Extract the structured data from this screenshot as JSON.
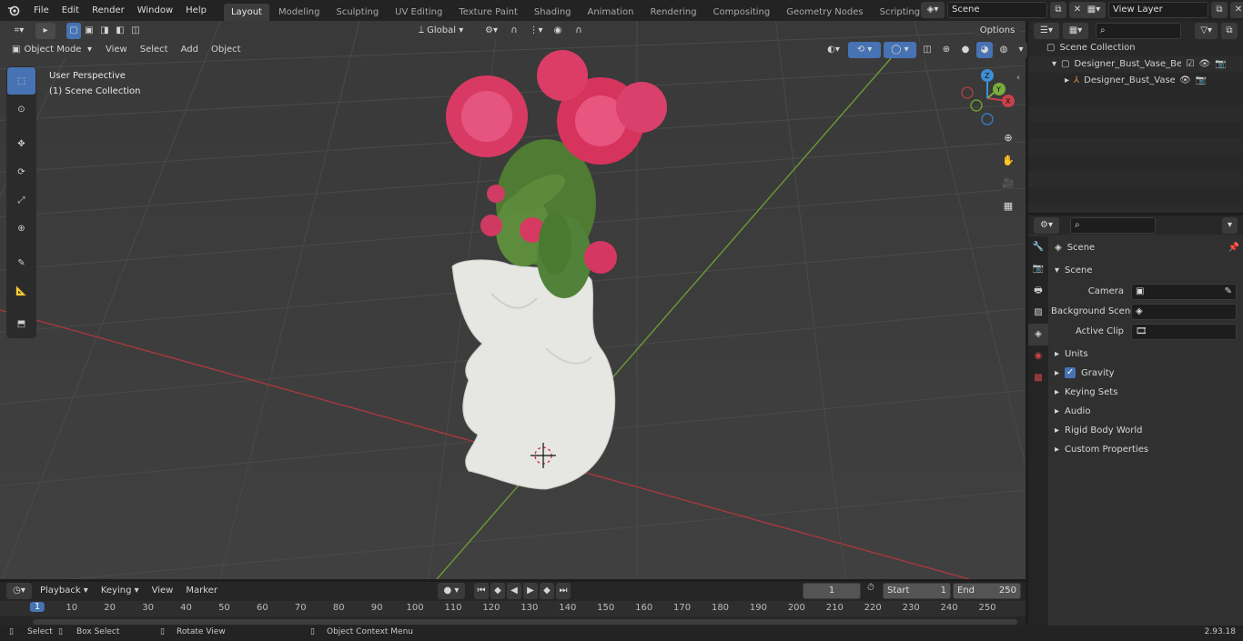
{
  "menubar": {
    "file": "File",
    "edit": "Edit",
    "render": "Render",
    "window": "Window",
    "help": "Help"
  },
  "workspaces": [
    "Layout",
    "Modeling",
    "Sculpting",
    "UV Editing",
    "Texture Paint",
    "Shading",
    "Animation",
    "Rendering",
    "Compositing",
    "Geometry Nodes",
    "Scripting"
  ],
  "active_workspace": "Layout",
  "scene_field": "Scene",
  "view_layer_field": "View Layer",
  "viewport_header": {
    "mode": "Object Mode",
    "view": "View",
    "select": "Select",
    "add": "Add",
    "object": "Object",
    "transform": "Global",
    "options": "Options"
  },
  "overlay_text": {
    "perspective": "User Perspective",
    "collection": "(1) Scene Collection"
  },
  "gizmo": {
    "x": "X",
    "y": "Y",
    "z": "Z"
  },
  "outliner": {
    "root": "Scene Collection",
    "items": [
      {
        "name": "Designer_Bust_Vase_Beige_w"
      },
      {
        "name": "Designer_Bust_Vase_Bei"
      }
    ]
  },
  "properties": {
    "header": "Scene",
    "section": "Scene",
    "camera_label": "Camera",
    "background_label": "Background Scene",
    "clip_label": "Active Clip",
    "panels": [
      "Units",
      "Gravity",
      "Keying Sets",
      "Audio",
      "Rigid Body World",
      "Custom Properties"
    ]
  },
  "timeline": {
    "playback": "Playback",
    "keying": "Keying",
    "view": "View",
    "marker": "Marker",
    "current_frame": "1",
    "start_label": "Start",
    "start_value": "1",
    "end_label": "End",
    "end_value": "250",
    "ticks": [
      "1",
      "10",
      "20",
      "30",
      "40",
      "50",
      "60",
      "70",
      "80",
      "90",
      "100",
      "110",
      "120",
      "130",
      "140",
      "150",
      "160",
      "170",
      "180",
      "190",
      "200",
      "210",
      "220",
      "230",
      "240",
      "250"
    ]
  },
  "statusbar": {
    "select": "Select",
    "box_select": "Box Select",
    "rotate": "Rotate View",
    "context": "Object Context Menu",
    "version": "2.93.18"
  },
  "colors": {
    "accent": "#4772b3",
    "x_axis": "#c8404a",
    "y_axis": "#7bac3e",
    "z_axis": "#3f8ed3"
  }
}
